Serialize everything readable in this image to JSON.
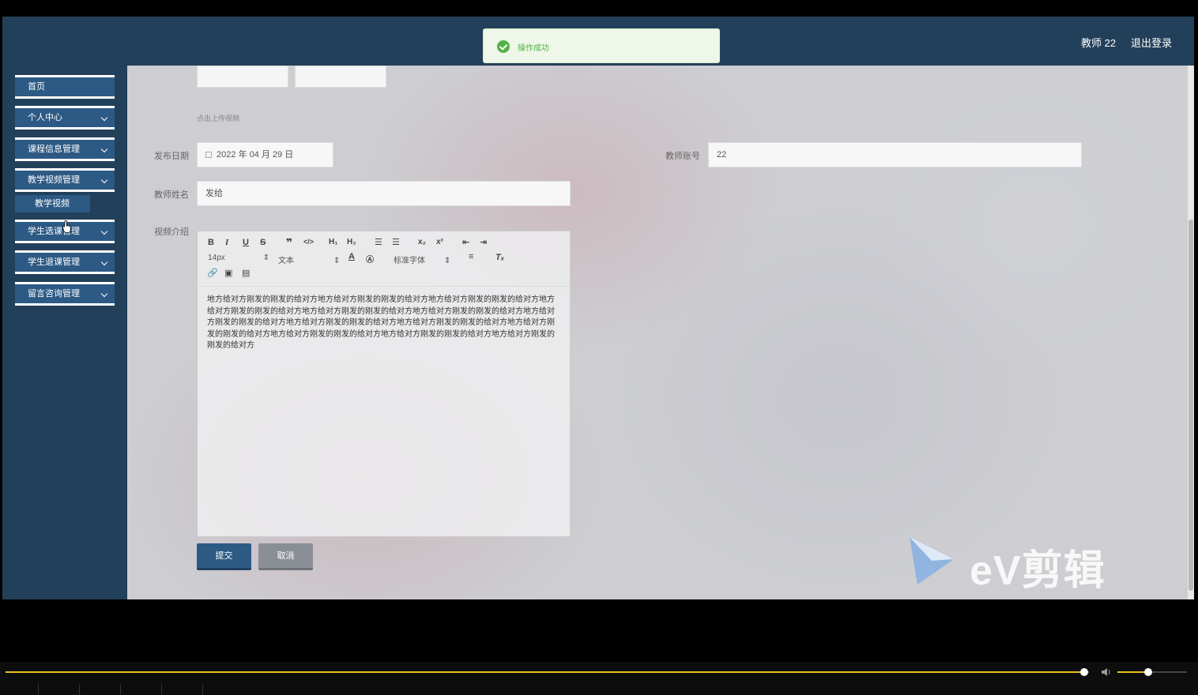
{
  "header": {
    "user": "教师 22",
    "logout": "退出登录"
  },
  "toast": {
    "message": "操作成功"
  },
  "sidebar": {
    "items": [
      {
        "label": "首页"
      },
      {
        "label": "个人中心"
      },
      {
        "label": "课程信息管理"
      },
      {
        "label": "教学视频管理"
      },
      {
        "label": "学生选课管理"
      },
      {
        "label": "学生退课管理"
      },
      {
        "label": "留言咨询管理"
      }
    ],
    "sub_item": "教学视频"
  },
  "form": {
    "upload_hint": "点击上传视频",
    "publish_date_label": "发布日期",
    "publish_date_value": "2022 年 04 月 29 日",
    "teacher_account_label": "教师账号",
    "teacher_account_value": "22",
    "teacher_name_label": "教师姓名",
    "teacher_name_value": "发给",
    "video_intro_label": "视频介绍",
    "editor": {
      "font_size": "14px",
      "block_type": "文本",
      "font_family": "标准字体",
      "content": "地方给对方刚发的刚发的给对方地方给对方刚发的刚发的给对方地方给对方刚发的刚发的给对方地方给对方刚发的刚发的给对方地方给对方刚发的刚发的给对方地方给对方刚发的刚发的给对方地方给对方刚发的刚发的给对方地方给对方刚发的刚发的给对方地方给对方刚发的刚发的给对方地方给对方刚发的刚发的给对方地方给对方刚发的刚发的给对方地方给对方刚发的刚发的给对方地方给对方刚发的刚发的给对方"
    },
    "submit": "提交",
    "cancel": "取消"
  },
  "watermark": "eV剪辑",
  "player": {
    "progress_fraction": 0.995,
    "volume_fraction": 0.45
  }
}
